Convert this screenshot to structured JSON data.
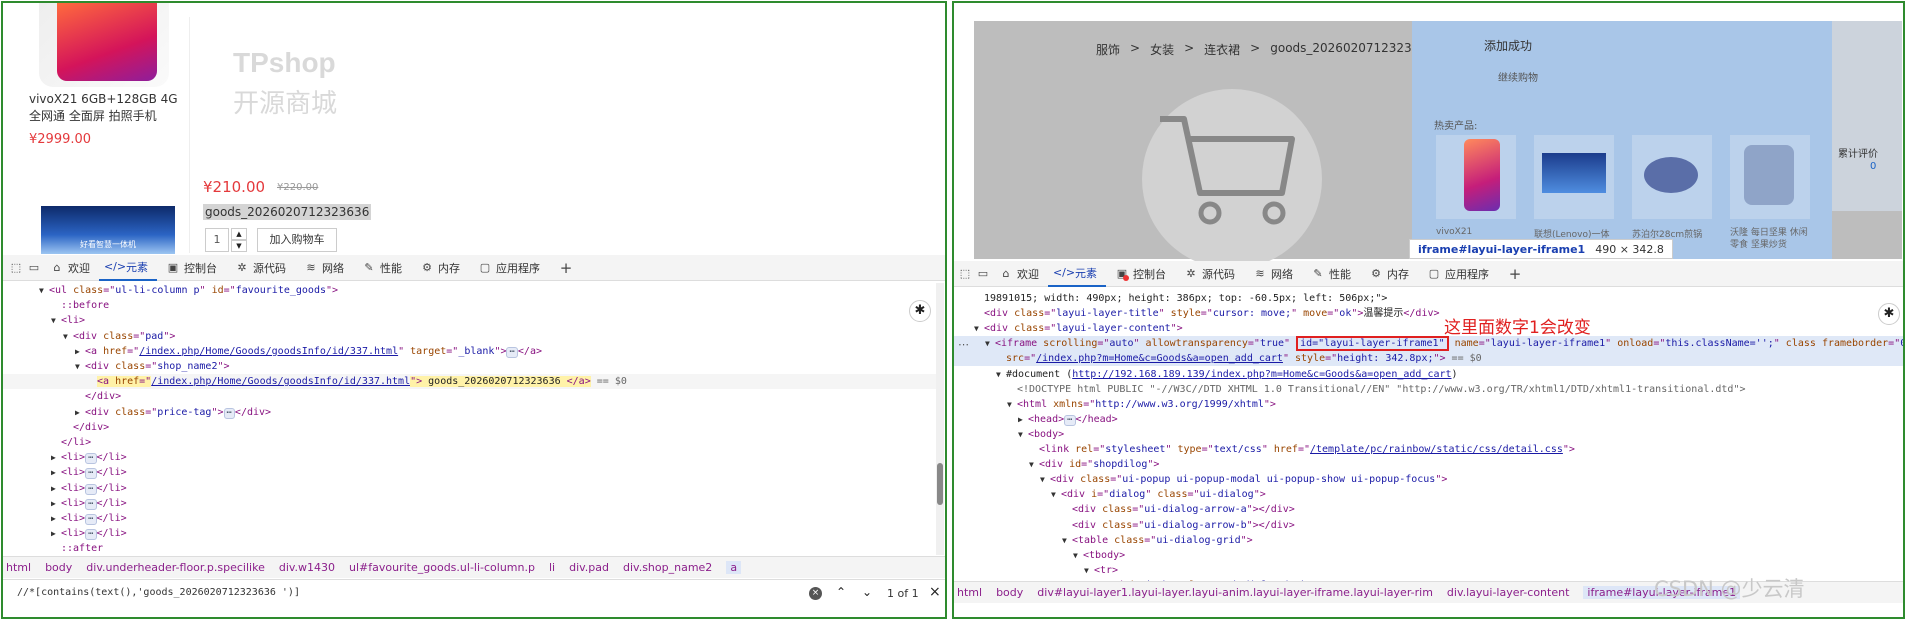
{
  "left": {
    "product": {
      "name": "vivoX21 6GB+128GB 4G全网通 全面屏 拍照手机",
      "price": "¥2999.00"
    },
    "logo": {
      "title": "TPshop",
      "subtitle": "开源商城"
    },
    "thumb_caption": "好看智慧一体机",
    "price": "¥210.00",
    "old_price": "¥220.00",
    "goods_name": "goods_2026020712323636",
    "qty": "1",
    "cart_button": "加入购物车",
    "tabs": [
      "欢迎",
      "元素",
      "控制台",
      "源代码",
      "网络",
      "性能",
      "内存",
      "应用程序"
    ],
    "code": [
      {
        "ind": 0,
        "tri": "▼",
        "parts": [
          [
            "t",
            "<ul "
          ],
          [
            "an",
            "class"
          ],
          [
            "t",
            "=\""
          ],
          [
            "av",
            "ul-li-column p"
          ],
          [
            "t",
            "\" "
          ],
          [
            "an",
            "id"
          ],
          [
            "t",
            "=\""
          ],
          [
            "av",
            "favourite_goods"
          ],
          [
            "t",
            "\">"
          ]
        ]
      },
      {
        "ind": 1,
        "tri": "",
        "parts": [
          [
            "t",
            "::before"
          ]
        ]
      },
      {
        "ind": 1,
        "tri": "▼",
        "parts": [
          [
            "t",
            "<li>"
          ]
        ]
      },
      {
        "ind": 2,
        "tri": "▼",
        "parts": [
          [
            "t",
            "<div "
          ],
          [
            "an",
            "class"
          ],
          [
            "t",
            "=\""
          ],
          [
            "av",
            "pad"
          ],
          [
            "t",
            "\">"
          ]
        ]
      },
      {
        "ind": 3,
        "tri": "▶",
        "parts": [
          [
            "t",
            "<a "
          ],
          [
            "an",
            "href"
          ],
          [
            "t",
            "=\""
          ],
          [
            "lk",
            "/index.php/Home/Goods/goodsInfo/id/337.html"
          ],
          [
            "t",
            "\" "
          ],
          [
            "an",
            "target"
          ],
          [
            "t",
            "=\""
          ],
          [
            "av",
            "_blank"
          ],
          [
            "t",
            "\">"
          ],
          [
            "ell",
            "⋯"
          ],
          [
            "t",
            "</a>"
          ]
        ]
      },
      {
        "ind": 3,
        "tri": "▼",
        "parts": [
          [
            "t",
            "<div "
          ],
          [
            "an",
            "class"
          ],
          [
            "t",
            "=\""
          ],
          [
            "av",
            "shop_name2"
          ],
          [
            "t",
            "\">"
          ]
        ]
      },
      {
        "ind": 4,
        "tri": "",
        "hl": true,
        "parts": [
          [
            "t",
            "<a "
          ],
          [
            "an",
            "href"
          ],
          [
            "t",
            "=\""
          ],
          [
            "lk",
            "/index.php/Home/Goods/goodsInfo/id/337.html"
          ],
          [
            "t",
            "\">"
          ],
          [
            "tx",
            " goods_2026020712323636 "
          ],
          [
            "t",
            "</a>"
          ],
          [
            "cm",
            " == $0"
          ]
        ]
      },
      {
        "ind": 3,
        "tri": "",
        "parts": [
          [
            "t",
            "</div>"
          ]
        ]
      },
      {
        "ind": 3,
        "tri": "▶",
        "parts": [
          [
            "t",
            "<div "
          ],
          [
            "an",
            "class"
          ],
          [
            "t",
            "=\""
          ],
          [
            "av",
            "price-tag"
          ],
          [
            "t",
            "\">"
          ],
          [
            "ell",
            "⋯"
          ],
          [
            "t",
            "</div>"
          ]
        ]
      },
      {
        "ind": 2,
        "tri": "",
        "parts": [
          [
            "t",
            "</div>"
          ]
        ]
      },
      {
        "ind": 1,
        "tri": "",
        "parts": [
          [
            "t",
            "</li>"
          ]
        ]
      },
      {
        "ind": 1,
        "tri": "▶",
        "parts": [
          [
            "t",
            "<li>"
          ],
          [
            "ell",
            "⋯"
          ],
          [
            "t",
            "</li>"
          ]
        ]
      },
      {
        "ind": 1,
        "tri": "▶",
        "parts": [
          [
            "t",
            "<li>"
          ],
          [
            "ell",
            "⋯"
          ],
          [
            "t",
            "</li>"
          ]
        ]
      },
      {
        "ind": 1,
        "tri": "▶",
        "parts": [
          [
            "t",
            "<li>"
          ],
          [
            "ell",
            "⋯"
          ],
          [
            "t",
            "</li>"
          ]
        ]
      },
      {
        "ind": 1,
        "tri": "▶",
        "parts": [
          [
            "t",
            "<li>"
          ],
          [
            "ell",
            "⋯"
          ],
          [
            "t",
            "</li>"
          ]
        ]
      },
      {
        "ind": 1,
        "tri": "▶",
        "parts": [
          [
            "t",
            "<li>"
          ],
          [
            "ell",
            "⋯"
          ],
          [
            "t",
            "</li>"
          ]
        ]
      },
      {
        "ind": 1,
        "tri": "▶",
        "parts": [
          [
            "t",
            "<li>"
          ],
          [
            "ell",
            "⋯"
          ],
          [
            "t",
            "</li>"
          ]
        ]
      },
      {
        "ind": 1,
        "tri": "",
        "parts": [
          [
            "t",
            "::after"
          ]
        ]
      }
    ],
    "breadcrumbs": [
      "html",
      "body",
      "div.underheader-floor.p.specilike",
      "div.w1430",
      "ul#favourite_goods.ul-li-column.p",
      "li",
      "div.pad",
      "div.shop_name2",
      "a"
    ],
    "search": {
      "value": "//*[contains(text(),'goods_2026020712323636 ')]",
      "count": "1 of 1"
    }
  },
  "right": {
    "breadcrumb": [
      "服饰",
      ">",
      "女装",
      ">",
      "连衣裙",
      ">",
      "goods_2026020712323636"
    ],
    "popup": {
      "title": "添加成功",
      "subtitle": "继续购物",
      "hot_label": "热卖产品:"
    },
    "products": [
      {
        "caption": "vivoX21"
      },
      {
        "caption": "联想(Lenovo)一体"
      },
      {
        "caption": "苏泊尔28cm煎锅"
      },
      {
        "caption": "沃隆 每日坚果 休闲零食 坚果炒货"
      }
    ],
    "side_label": "累计评价",
    "side_count": "0",
    "tooltip": {
      "name": "iframe#layui-layer-iframe1",
      "size": "490 × 342.8"
    },
    "tabs": [
      "欢迎",
      "元素",
      "控制台",
      "源代码",
      "网络",
      "性能",
      "内存",
      "应用程序"
    ],
    "annotation": "这里面数字1会改变",
    "code": [
      {
        "ind": 0,
        "tri": "",
        "parts": [
          [
            "tx",
            "19891015; width: 490px; height: 386px; top: -60.5px; left: 506px;\">"
          ]
        ]
      },
      {
        "ind": 0,
        "tri": "",
        "parts": [
          [
            "t",
            "<div "
          ],
          [
            "an",
            "class"
          ],
          [
            "t",
            "=\""
          ],
          [
            "av",
            "layui-layer-title"
          ],
          [
            "t",
            "\" "
          ],
          [
            "an",
            "style"
          ],
          [
            "t",
            "=\""
          ],
          [
            "av",
            "cursor: move;"
          ],
          [
            "t",
            "\" "
          ],
          [
            "an",
            "move"
          ],
          [
            "t",
            "=\""
          ],
          [
            "av",
            "ok"
          ],
          [
            "t",
            "\">"
          ],
          [
            "tx",
            "温馨提示"
          ],
          [
            "t",
            "</div>"
          ]
        ]
      },
      {
        "ind": 0,
        "tri": "▼",
        "parts": [
          [
            "t",
            "<div "
          ],
          [
            "an",
            "class"
          ],
          [
            "t",
            "=\""
          ],
          [
            "av",
            "layui-layer-content"
          ],
          [
            "t",
            "\">"
          ]
        ]
      },
      {
        "ind": 1,
        "tri": "▼",
        "hl": true,
        "parts": [
          [
            "t",
            "<iframe "
          ],
          [
            "an",
            "scrolling"
          ],
          [
            "t",
            "=\""
          ],
          [
            "av",
            "auto"
          ],
          [
            "t",
            "\" "
          ],
          [
            "an",
            "allowtransparency"
          ],
          [
            "t",
            "=\""
          ],
          [
            "av",
            "true"
          ],
          [
            "t",
            "\" "
          ],
          [
            "box",
            "id=\"layui-layer-iframe1\""
          ],
          [
            "t",
            " "
          ],
          [
            "an",
            "name"
          ],
          [
            "t",
            "=\""
          ],
          [
            "av",
            "layui-layer-iframe1"
          ],
          [
            "t",
            "\" "
          ],
          [
            "an",
            "onload"
          ],
          [
            "t",
            "=\""
          ],
          [
            "av",
            "this.className='';"
          ],
          [
            "t",
            "\" "
          ],
          [
            "an",
            "class"
          ],
          [
            "t",
            " "
          ],
          [
            "an",
            "frameborder"
          ],
          [
            "t",
            "=\""
          ],
          [
            "av",
            "0"
          ],
          [
            "t",
            "\""
          ]
        ]
      },
      {
        "ind": 2,
        "tri": "",
        "hl": true,
        "parts": [
          [
            "an",
            "src"
          ],
          [
            "t",
            "=\""
          ],
          [
            "lk",
            "/index.php?m=Home&c=Goods&a=open_add_cart"
          ],
          [
            "t",
            "\" "
          ],
          [
            "an",
            "style"
          ],
          [
            "t",
            "=\""
          ],
          [
            "av",
            "height: 342.8px;"
          ],
          [
            "t",
            "\">"
          ],
          [
            "cm",
            " == $0"
          ]
        ]
      },
      {
        "ind": 2,
        "tri": "▼",
        "parts": [
          [
            "tx",
            "#document ("
          ],
          [
            "lk",
            "http://192.168.189.139/index.php?m=Home&c=Goods&a=open_add_cart"
          ],
          [
            "tx",
            ")"
          ]
        ]
      },
      {
        "ind": 3,
        "tri": "",
        "parts": [
          [
            "cm",
            "<!DOCTYPE html PUBLIC \"-//W3C//DTD XHTML 1.0 Transitional//EN\" \"http://www.w3.org/TR/xhtml1/DTD/xhtml1-transitional.dtd\">"
          ]
        ]
      },
      {
        "ind": 3,
        "tri": "▼",
        "parts": [
          [
            "t",
            "<html "
          ],
          [
            "an",
            "xmlns"
          ],
          [
            "t",
            "=\""
          ],
          [
            "av",
            "http://www.w3.org/1999/xhtml"
          ],
          [
            "t",
            "\">"
          ]
        ]
      },
      {
        "ind": 4,
        "tri": "▶",
        "parts": [
          [
            "t",
            "<head>"
          ],
          [
            "ell",
            "⋯"
          ],
          [
            "t",
            "</head>"
          ]
        ]
      },
      {
        "ind": 4,
        "tri": "▼",
        "parts": [
          [
            "t",
            "<body>"
          ]
        ]
      },
      {
        "ind": 5,
        "tri": "",
        "parts": [
          [
            "t",
            "<link "
          ],
          [
            "an",
            "rel"
          ],
          [
            "t",
            "=\""
          ],
          [
            "av",
            "stylesheet"
          ],
          [
            "t",
            "\" "
          ],
          [
            "an",
            "type"
          ],
          [
            "t",
            "=\""
          ],
          [
            "av",
            "text/css"
          ],
          [
            "t",
            "\" "
          ],
          [
            "an",
            "href"
          ],
          [
            "t",
            "=\""
          ],
          [
            "lk",
            "/template/pc/rainbow/static/css/detail.css"
          ],
          [
            "t",
            "\">"
          ]
        ]
      },
      {
        "ind": 5,
        "tri": "▼",
        "parts": [
          [
            "t",
            "<div "
          ],
          [
            "an",
            "id"
          ],
          [
            "t",
            "=\""
          ],
          [
            "av",
            "shopdilog"
          ],
          [
            "t",
            "\">"
          ]
        ]
      },
      {
        "ind": 6,
        "tri": "▼",
        "parts": [
          [
            "t",
            "<div "
          ],
          [
            "an",
            "class"
          ],
          [
            "t",
            "=\""
          ],
          [
            "av",
            "ui-popup ui-popup-modal ui-popup-show ui-popup-focus"
          ],
          [
            "t",
            "\">"
          ]
        ]
      },
      {
        "ind": 7,
        "tri": "▼",
        "parts": [
          [
            "t",
            "<div "
          ],
          [
            "an",
            "i"
          ],
          [
            "t",
            "=\""
          ],
          [
            "av",
            "dialog"
          ],
          [
            "t",
            "\" "
          ],
          [
            "an",
            "class"
          ],
          [
            "t",
            "=\""
          ],
          [
            "av",
            "ui-dialog"
          ],
          [
            "t",
            "\">"
          ]
        ]
      },
      {
        "ind": 8,
        "tri": "",
        "parts": [
          [
            "t",
            "<div "
          ],
          [
            "an",
            "class"
          ],
          [
            "t",
            "=\""
          ],
          [
            "av",
            "ui-dialog-arrow-a"
          ],
          [
            "t",
            "\"></div>"
          ]
        ]
      },
      {
        "ind": 8,
        "tri": "",
        "parts": [
          [
            "t",
            "<div "
          ],
          [
            "an",
            "class"
          ],
          [
            "t",
            "=\""
          ],
          [
            "av",
            "ui-dialog-arrow-b"
          ],
          [
            "t",
            "\"></div>"
          ]
        ]
      },
      {
        "ind": 8,
        "tri": "▼",
        "parts": [
          [
            "t",
            "<table "
          ],
          [
            "an",
            "class"
          ],
          [
            "t",
            "=\""
          ],
          [
            "av",
            "ui-dialog-grid"
          ],
          [
            "t",
            "\">"
          ]
        ]
      },
      {
        "ind": 9,
        "tri": "▼",
        "parts": [
          [
            "t",
            "<tbody>"
          ]
        ]
      },
      {
        "ind": 10,
        "tri": "▼",
        "parts": [
          [
            "t",
            "<tr>"
          ]
        ]
      },
      {
        "ind": 11,
        "tri": "",
        "parts": [
          [
            "t",
            "<td "
          ],
          [
            "an",
            "i"
          ],
          [
            "t",
            "=\""
          ],
          [
            "av",
            "body"
          ],
          [
            "t",
            "\" "
          ],
          [
            "an",
            "class"
          ],
          [
            "t",
            "=\""
          ],
          [
            "av",
            "ui-dialog-body"
          ],
          [
            "t",
            "\">"
          ]
        ]
      }
    ],
    "breadcrumbs": [
      "html",
      "body",
      "div#layui-layer1.layui-layer.layui-anim.layui-layer-iframe.layui-layer-rim",
      "div.layui-layer-content",
      "iframe#layui-layer-iframe1"
    ],
    "watermark": "CSDN @少云清"
  }
}
